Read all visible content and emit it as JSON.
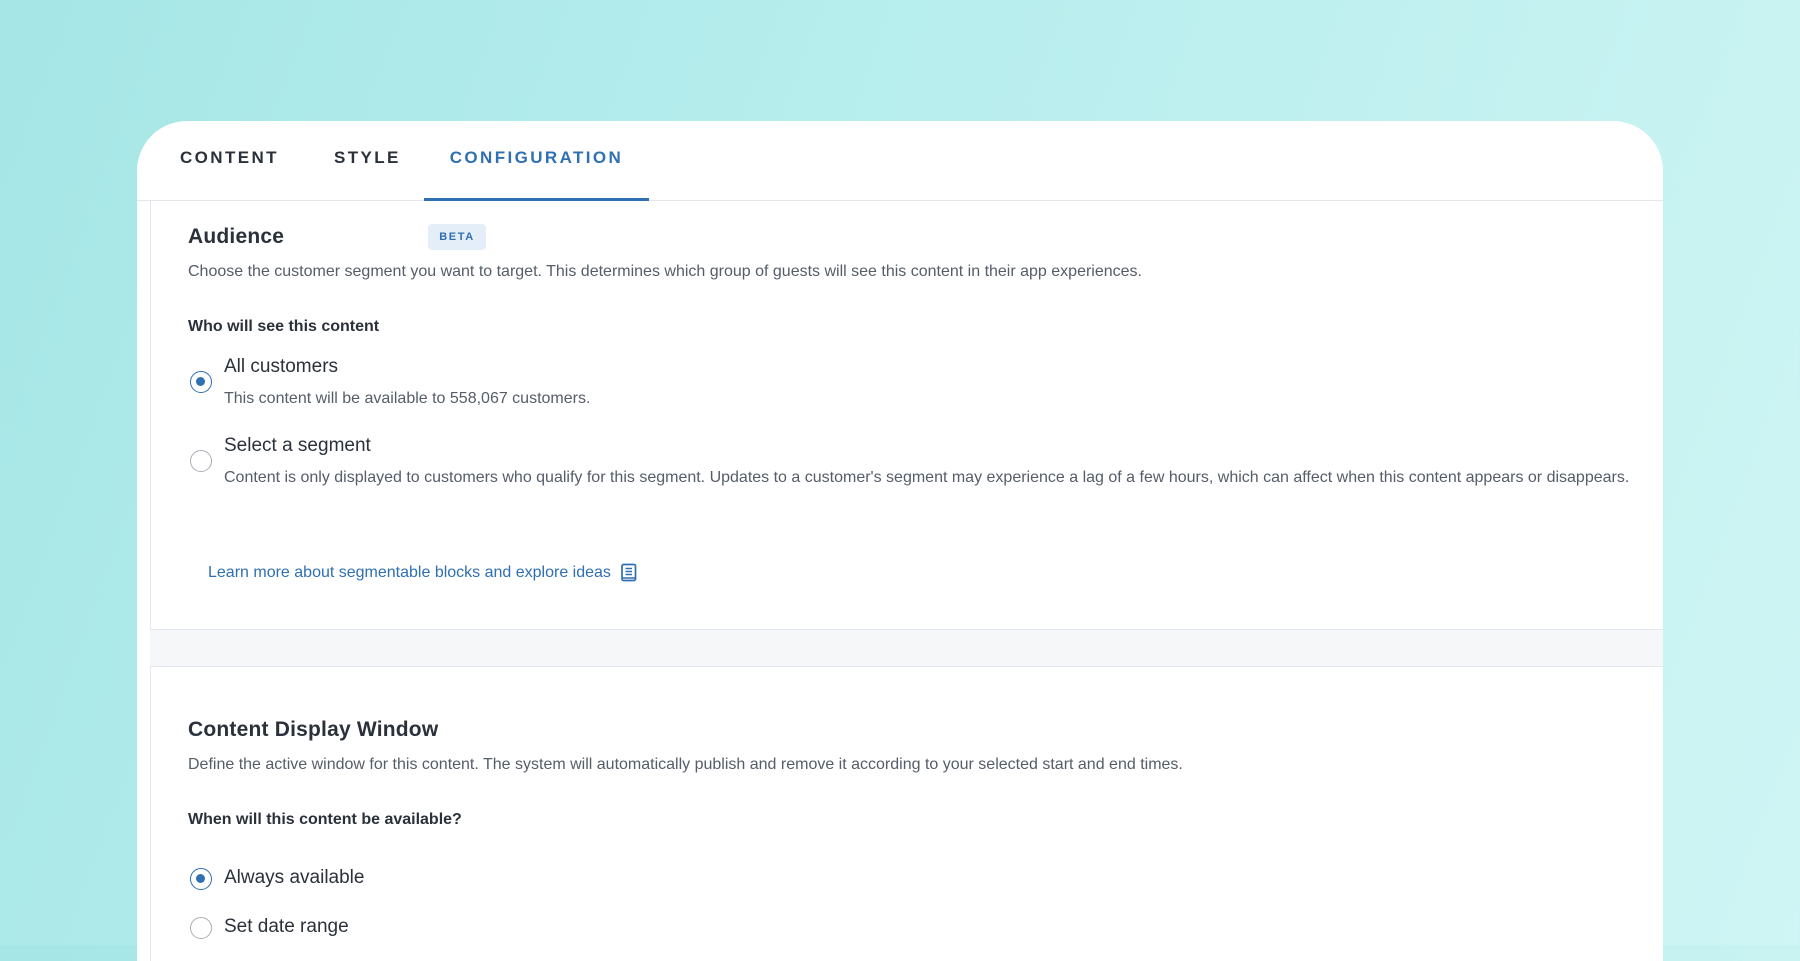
{
  "tabs": [
    {
      "label": "CONTENT"
    },
    {
      "label": "STYLE"
    },
    {
      "label": "CONFIGURATION",
      "active": true
    }
  ],
  "audience": {
    "title": "Audience",
    "badge": "BETA",
    "description": "Choose the customer segment you want to target. This determines which group of guests will see this content in their app experiences.",
    "question": "Who will see this content",
    "options": [
      {
        "label": "All customers",
        "help": "This content will be available to 558,067 customers.",
        "selected": true
      },
      {
        "label": "Select a segment",
        "help": "Content is only displayed to customers who qualify for this segment. Updates to a customer's segment may experience a lag of a few hours, which can affect when this content appears or disappears.",
        "selected": false
      }
    ],
    "learn_more": "Learn more about segmentable blocks and explore ideas",
    "learn_more_icon": "book-icon"
  },
  "display_window": {
    "title": "Content Display Window",
    "description": "Define the active window for this content. The system will automatically publish and remove it according to your selected start and end times.",
    "question": "When will this content be available?",
    "options": [
      {
        "label": "Always available",
        "selected": true
      },
      {
        "label": "Set date range",
        "selected": false
      }
    ]
  },
  "colors": {
    "accent": "#2f6fb3",
    "background_start": "#a6e6e6",
    "background_end": "#cff5f4",
    "badge_bg": "#e4eef8"
  }
}
